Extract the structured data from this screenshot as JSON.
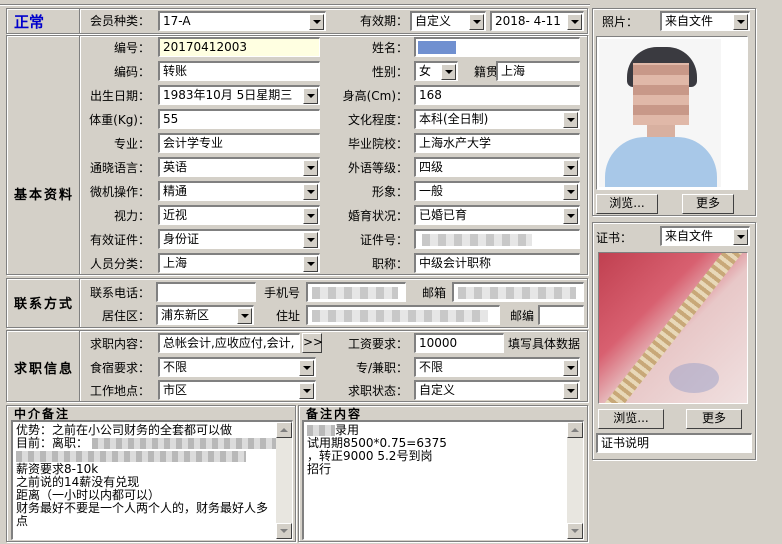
{
  "status": "正常",
  "membership": {
    "label": "会员种类：",
    "value": "17-A"
  },
  "validity": {
    "label": "有效期：",
    "type": "自定义",
    "date": "2018- 4-11"
  },
  "sections": {
    "basic": "基本资料",
    "contact": "联系方式",
    "job": "求职信息"
  },
  "basic": {
    "number": {
      "label": "编号：",
      "value": "20170412003"
    },
    "name": {
      "label": "姓名：",
      "value": ""
    },
    "code": {
      "label": "编码：",
      "value": "转账"
    },
    "gender": {
      "label": "性别：",
      "value": "女"
    },
    "native": {
      "label": "籍贯",
      "value": "上海"
    },
    "birth": {
      "label": "出生日期：",
      "value": "1983年10月 5日星期三"
    },
    "height": {
      "label": "身高(Cm)：",
      "value": "168"
    },
    "weight": {
      "label": "体重(Kg)：",
      "value": "55"
    },
    "education": {
      "label": "文化程度：",
      "value": "本科(全日制)"
    },
    "major": {
      "label": "专业：",
      "value": "会计学专业"
    },
    "school": {
      "label": "毕业院校：",
      "value": "上海水产大学"
    },
    "language": {
      "label": "通晓语言：",
      "value": "英语"
    },
    "foreign_level": {
      "label": "外语等级：",
      "value": "四级"
    },
    "computer": {
      "label": "微机操作：",
      "value": "精通"
    },
    "image": {
      "label": "形象：",
      "value": "一般"
    },
    "eyesight": {
      "label": "视力：",
      "value": "近视"
    },
    "marital": {
      "label": "婚育状况：",
      "value": "已婚已育"
    },
    "id_type": {
      "label": "有效证件：",
      "value": "身份证"
    },
    "id_number": {
      "label": "证件号：",
      "value": ""
    },
    "category": {
      "label": "人员分类：",
      "value": "上海"
    },
    "title": {
      "label": "职称：",
      "value": "中级会计职称"
    }
  },
  "contact": {
    "phone_label": "联系电话：",
    "mobile_label": "手机号",
    "email_label": "邮箱",
    "residence": {
      "label": "居住区：",
      "value": "浦东新区"
    },
    "address_label": "住址",
    "postcode_label": "邮编"
  },
  "job": {
    "content": {
      "label": "求职内容：",
      "value": "总帐会计,应收应付,会计,"
    },
    "more": ">>",
    "salary": {
      "label": "工资要求：",
      "value": "10000",
      "note": "填写具体数据"
    },
    "board": {
      "label": "食宿要求：",
      "value": "不限"
    },
    "parttime": {
      "label": "专/兼职：",
      "value": "不限"
    },
    "location": {
      "label": "工作地点：",
      "value": "市区"
    },
    "status": {
      "label": "求职状态：",
      "value": "自定义"
    }
  },
  "agent_note": {
    "title": "中介备注",
    "lines": [
      "优势：之前在小公司财务的全套都可以做",
      "目前：离职：",
      "",
      "薪资要求8-10k",
      "之前说的14薪没有兑现",
      "距离（一小时以内都可以）",
      "财务最好不要是一个人两个人的，财务最好人多",
      "点"
    ]
  },
  "remark": {
    "title": "备注内容",
    "lines": [
      "录用",
      "试用期8500*0.75=6375",
      "，转正9000    5.2号到岗",
      "招行"
    ]
  },
  "photo": {
    "label": "照片：",
    "source": "来自文件",
    "browse": "浏览...",
    "more": "更多"
  },
  "cert": {
    "label": "证书：",
    "source": "来自文件",
    "browse": "浏览...",
    "more": "更多",
    "desc": "证书说明"
  },
  "colors": {
    "status": "#0000cc",
    "background": "#d4d0c8",
    "highlight": "#ffffe1"
  }
}
